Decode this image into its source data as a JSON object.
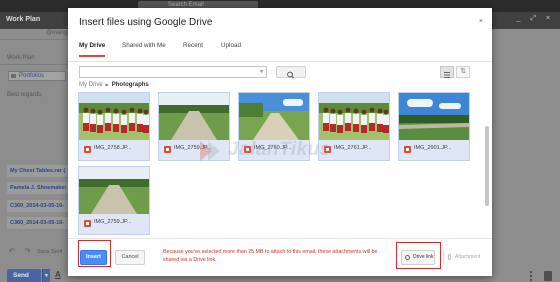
{
  "background": {
    "search_text": "Search Email",
    "compose_title": "Work Plan",
    "recipient_email": "@mangp...",
    "subject": "Work Plan",
    "chip_label": "Portfolios",
    "body_text": "Best regards,",
    "attachments": [
      "My Chest Tables.rar (",
      "Pamela J. Shoemaker",
      "C360_2014-03-05-16-",
      "C360_2014-03-05-16-"
    ],
    "font_label": "Sans Serif",
    "send_label": "Send"
  },
  "dialog": {
    "title": "Insert files using Google Drive",
    "close_icon": "×",
    "tabs": [
      {
        "label": "My Drive",
        "active": true
      },
      {
        "label": "Shared with Me",
        "active": false
      },
      {
        "label": "Recent",
        "active": false
      },
      {
        "label": "Upload",
        "active": false
      }
    ],
    "search_placeholder": "",
    "breadcrumb": {
      "root": "My Drive",
      "separator": "▶",
      "current": "Photographs"
    },
    "files": [
      {
        "name": "IMG_2758.JP...",
        "scene": "kids"
      },
      {
        "name": "IMG_2759.JP...",
        "scene": "road"
      },
      {
        "name": "IMG_2760.JP...",
        "scene": "road2"
      },
      {
        "name": "IMG_2761.JP...",
        "scene": "kids"
      },
      {
        "name": "IMG_2901.JP...",
        "scene": "sky"
      },
      {
        "name": "IMG_2759.JP...",
        "scene": "road"
      }
    ],
    "insert_label": "Insert",
    "cancel_label": "Cancel",
    "notice": "Because you've selected more than 25 MB to attach to this email, these attachments will be shared via a Drive link.",
    "drive_link_label": "Drive link",
    "attachment_label": "Attachment"
  },
  "watermark": "JalanTikus",
  "colors": {
    "accent_blue": "#4b8bf4",
    "tab_active": "#dd4b39",
    "notice_red": "#c0392b",
    "highlight_red": "#d62b2b"
  }
}
